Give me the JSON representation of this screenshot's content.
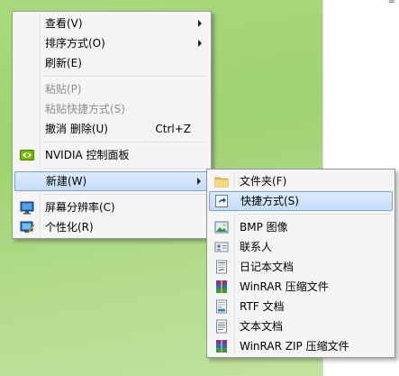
{
  "desktop": {
    "corner_text": "≡"
  },
  "context_menu": {
    "items": [
      {
        "label": "查看(V)"
      },
      {
        "label": "排序方式(O)"
      },
      {
        "label": "刷新(E)"
      },
      {
        "label": "粘贴(P)"
      },
      {
        "label": "粘贴快捷方式(S)"
      },
      {
        "label": "撤消 删除(U)",
        "shortcut": "Ctrl+Z"
      },
      {
        "label": "NVIDIA 控制面板",
        "icon": "nvidia-icon"
      },
      {
        "label": "新建(W)"
      },
      {
        "label": "屏幕分辨率(C)",
        "icon": "display-icon"
      },
      {
        "label": "个性化(R)",
        "icon": "personalize-icon"
      }
    ]
  },
  "new_submenu": {
    "items": [
      {
        "label": "文件夹(F)",
        "icon": "folder-icon"
      },
      {
        "label": "快捷方式(S)",
        "icon": "shortcut-icon"
      },
      {
        "label": "BMP 图像",
        "icon": "bmp-image-icon"
      },
      {
        "label": "联系人",
        "icon": "contact-icon"
      },
      {
        "label": "日记本文档",
        "icon": "journal-document-icon"
      },
      {
        "label": "WinRAR 压缩文件",
        "icon": "winrar-icon"
      },
      {
        "label": "RTF 文档",
        "icon": "rtf-document-icon"
      },
      {
        "label": "文本文档",
        "icon": "text-document-icon"
      },
      {
        "label": "WinRAR ZIP 压缩文件",
        "icon": "winrar-zip-icon"
      }
    ]
  },
  "colors": {
    "highlight_border": "#7da2ce",
    "highlight_fill": "#c4ddf8",
    "menu_background": "#f5f5f5",
    "disabled_text": "#8d8d8d",
    "desktop_green": "#a9d97d"
  }
}
